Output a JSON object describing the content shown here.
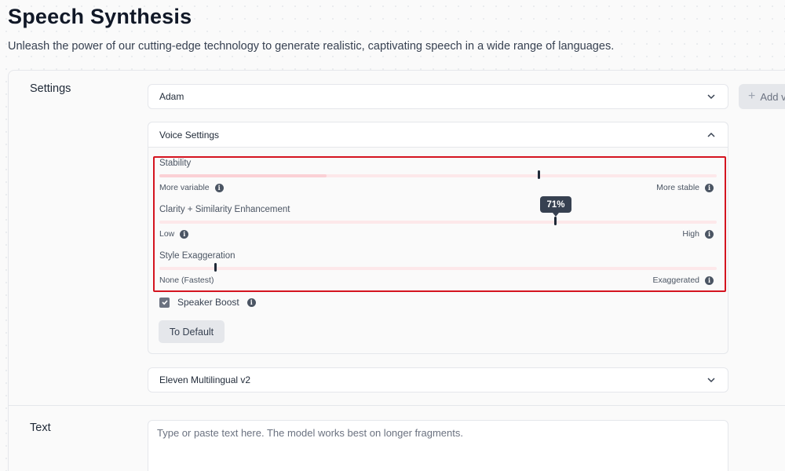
{
  "header": {
    "title": "Speech Synthesis",
    "subtitle": "Unleash the power of our cutting-edge technology to generate realistic, captivating speech in a wide range of languages."
  },
  "settings": {
    "label": "Settings",
    "voice_select": {
      "value": "Adam",
      "icon": "chevron-down-icon"
    },
    "add_voice_button": {
      "label": "Add v",
      "icon": "plus-icon"
    },
    "voice_settings": {
      "title": "Voice Settings",
      "icon": "chevron-up-icon",
      "sliders": [
        {
          "label": "Stability",
          "value_fraction": 0.68,
          "fill_fraction": 0.3,
          "min_label": "More variable",
          "max_label": "More stable"
        },
        {
          "label": "Clarity + Similarity Enhancement",
          "value_fraction": 0.71,
          "tooltip": "71%",
          "min_label": "Low",
          "max_label": "High"
        },
        {
          "label": "Style Exaggeration",
          "value_fraction": 0.1,
          "min_label": "None (Fastest)",
          "max_label": "Exaggerated"
        }
      ],
      "speaker_boost": {
        "label": "Speaker Boost",
        "checked": true
      },
      "to_default_label": "To Default"
    },
    "model_select": {
      "value": "Eleven Multilingual v2",
      "icon": "chevron-down-icon"
    }
  },
  "text_section": {
    "label": "Text",
    "placeholder": "Type or paste text here. The model works best on longer fragments."
  },
  "colors": {
    "highlight": "#d4141f",
    "slider_track": "#fde8ea",
    "tooltip_bg": "#374151"
  }
}
